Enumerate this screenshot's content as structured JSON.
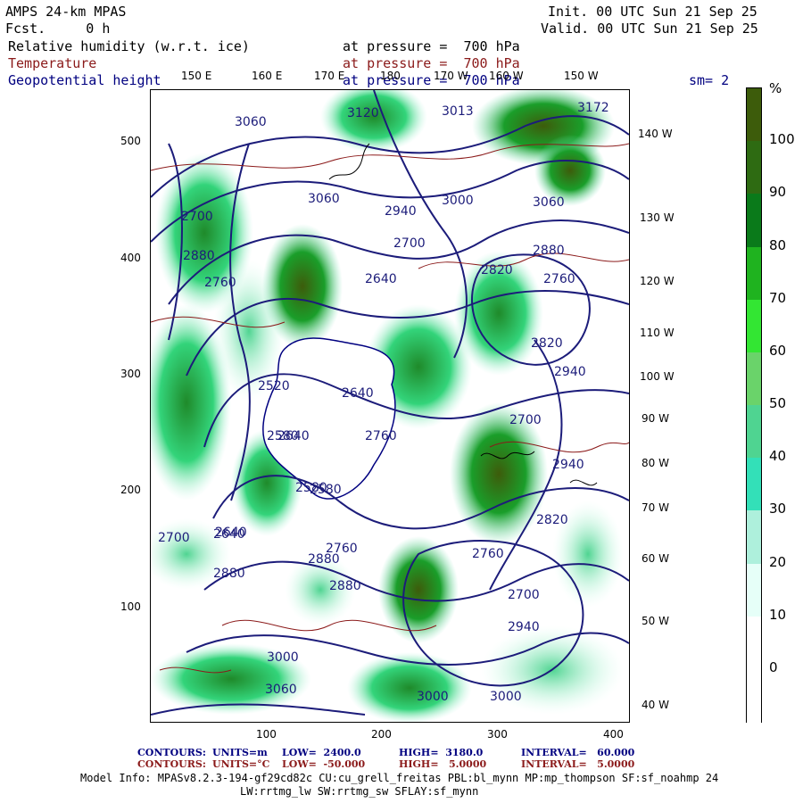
{
  "header": {
    "model_name": "AMPS 24-km MPAS",
    "forecast": "Fcst.     0 h",
    "init_time": "Init. 00 UTC Sun 21 Sep 25",
    "valid_time": "Valid. 00 UTC Sun 21 Sep 25"
  },
  "fields": [
    {
      "name": "Relative humidity (w.r.t. ice)",
      "level": "at pressure =  700 hPa",
      "color": "#000000"
    },
    {
      "name": "Temperature",
      "level": "at pressure =  700 hPa",
      "color": "#8b1a1a"
    },
    {
      "name": "Geopotential height",
      "level": "at pressure =  700 hPa",
      "color": "#000080"
    }
  ],
  "smoothing": "sm= 2",
  "colorbar": {
    "unit": "%",
    "labels": [
      "100",
      "90",
      "80",
      "70",
      "60",
      "50",
      "40",
      "30",
      "20",
      "10",
      "0"
    ],
    "colors": [
      "#3d5c0b",
      "#2e6b12",
      "#0a7a1a",
      "#1fb31f",
      "#33e633",
      "#6ad36a",
      "#4fd491",
      "#33e0b8",
      "#aef0dc",
      "#e6fff8",
      "#ffffff",
      "#ffffff"
    ]
  },
  "axes": {
    "x_ticks": [
      "100",
      "200",
      "300",
      "400"
    ],
    "y_ticks": [
      "500",
      "400",
      "300",
      "200",
      "100"
    ]
  },
  "lon_labels_top": [
    "150 E",
    "160 E",
    "170 E",
    "180",
    "170 W",
    "160 W",
    "150 W"
  ],
  "lon_labels_right": [
    "140 W",
    "130 W",
    "120 W",
    "110 W",
    "100 W",
    "90 W",
    "80 W",
    "70 W",
    "60 W",
    "50 W",
    "40 W"
  ],
  "contour_labels": [
    "3060",
    "3120",
    "3013",
    "3172",
    "2940",
    "3000",
    "3060",
    "3060",
    "2820",
    "2760",
    "2880",
    "2700",
    "2640",
    "2640",
    "2760",
    "2580",
    "2880",
    "2580",
    "2700",
    "2640",
    "2760",
    "2880",
    "3000",
    "2880",
    "2760",
    "2820",
    "2940",
    "2700",
    "3000",
    "3060",
    "2820",
    "2940",
    "2700",
    "2640",
    "2580",
    "2640",
    "2700",
    "2520",
    "2760",
    "2880",
    "2940",
    "3000"
  ],
  "footer": {
    "line1_label": "CONTOURS:",
    "line1_units": "UNITS=m",
    "line1_low": "LOW=  2400.0",
    "line1_high": "HIGH=  3180.0",
    "line1_interval": "INTERVAL=   60.000",
    "line2_label": "CONTOURS:",
    "line2_units": "UNITS=°C",
    "line2_low": "LOW=  -50.000",
    "line2_high": "HIGH=   5.0000",
    "line2_interval": "INTERVAL=   5.0000",
    "model_info": "Model Info: MPASv8.2.3-194-gf29cd82c CU:cu_grell_freitas PBL:bl_mynn MP:mp_thompson SF:sf_noahmp 24",
    "model_info2": "LW:rrtmg_lw SW:rrtmg_sw SFLAY:sf_mynn"
  }
}
